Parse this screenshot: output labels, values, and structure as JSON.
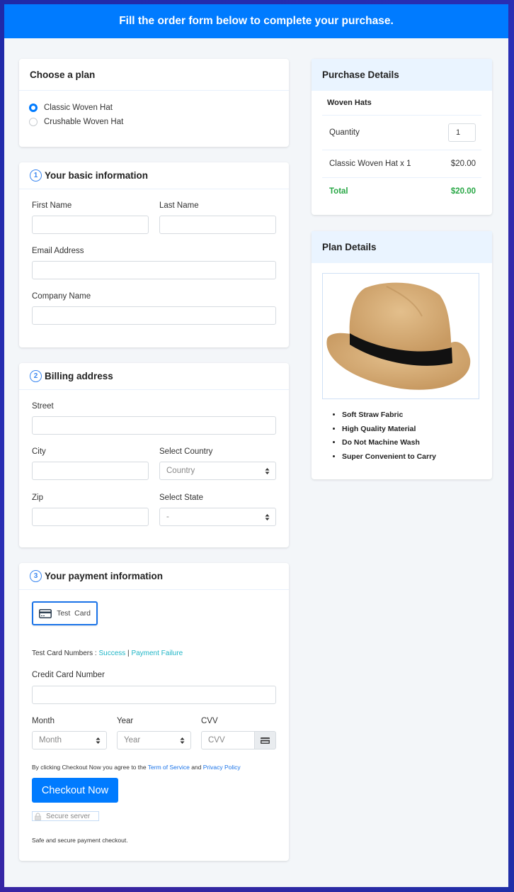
{
  "header": {
    "title": "Fill the order form below to complete your purchase."
  },
  "plan": {
    "title": "Choose a plan",
    "options": [
      {
        "label": "Classic Woven Hat",
        "selected": true
      },
      {
        "label": "Crushable Woven Hat",
        "selected": false
      }
    ]
  },
  "basic": {
    "step": "1",
    "title": "Your basic information",
    "first_name_label": "First Name",
    "last_name_label": "Last Name",
    "email_label": "Email Address",
    "company_label": "Company Name"
  },
  "billing": {
    "step": "2",
    "title": "Billing address",
    "street_label": "Street",
    "city_label": "City",
    "country_label": "Select Country",
    "country_value": "Country",
    "zip_label": "Zip",
    "state_label": "Select State",
    "state_value": "-"
  },
  "payment": {
    "step": "3",
    "title": "Your payment information",
    "card_button": "Test  Card",
    "test_numbers_label": "Test Card Numbers : ",
    "success_link": "Success",
    "separator": " | ",
    "failure_link": "Payment Failure",
    "cc_label": "Credit Card Number",
    "month_label": "Month",
    "month_value": "Month",
    "year_label": "Year",
    "year_value": "Year",
    "cvv_label": "CVV",
    "cvv_placeholder": "CVV",
    "agree_prefix": "By clicking Checkout Now you agree to the ",
    "terms_link": "Term of Service",
    "agree_and": " and ",
    "privacy_link": "Privacy Policy",
    "checkout_button": "Checkout Now",
    "secure_badge": "Secure server",
    "safe_text": "Safe and secure payment checkout."
  },
  "purchase": {
    "title": "Purchase Details",
    "product": "Woven Hats",
    "quantity_label": "Quantity",
    "quantity_value": "1",
    "line_item": "Classic Woven Hat x 1",
    "line_price": "$20.00",
    "total_label": "Total",
    "total_value": "$20.00",
    "total_color": "#28a745"
  },
  "plan_details": {
    "title": "Plan Details",
    "image_alt": "straw fedora hat",
    "features": [
      "Soft Straw Fabric",
      "High Quality Material",
      "Do Not Machine Wash",
      "Super Convenient to Carry"
    ]
  }
}
